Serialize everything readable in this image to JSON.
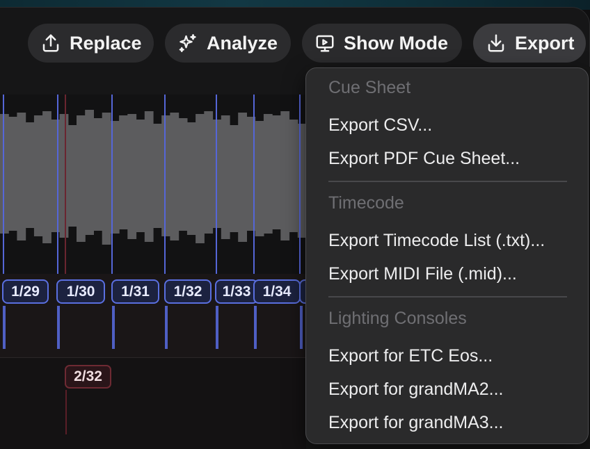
{
  "toolbar": {
    "replace_label": "Replace",
    "analyze_label": "Analyze",
    "show_mode_label": "Show Mode",
    "export_label": "Export"
  },
  "markers": {
    "blue": [
      "1/29",
      "1/30",
      "1/31",
      "1/32",
      "1/33",
      "1/34"
    ],
    "red": [
      "2/32"
    ]
  },
  "export_menu": {
    "sections": [
      {
        "title": "Cue Sheet",
        "items": [
          "Export CSV...",
          "Export PDF Cue Sheet..."
        ]
      },
      {
        "title": "Timecode",
        "items": [
          "Export Timecode List (.txt)...",
          "Export MIDI File (.mid)..."
        ]
      },
      {
        "title": "Lighting Consoles",
        "items": [
          "Export for ETC Eos...",
          "Export for grandMA2...",
          "Export for grandMA3..."
        ]
      }
    ]
  },
  "colors": {
    "marker_blue": "#5a6fe0",
    "marker_red": "#6e2a33",
    "waveform": "#5c5c5e",
    "menu_bg": "#2a2a2b"
  }
}
